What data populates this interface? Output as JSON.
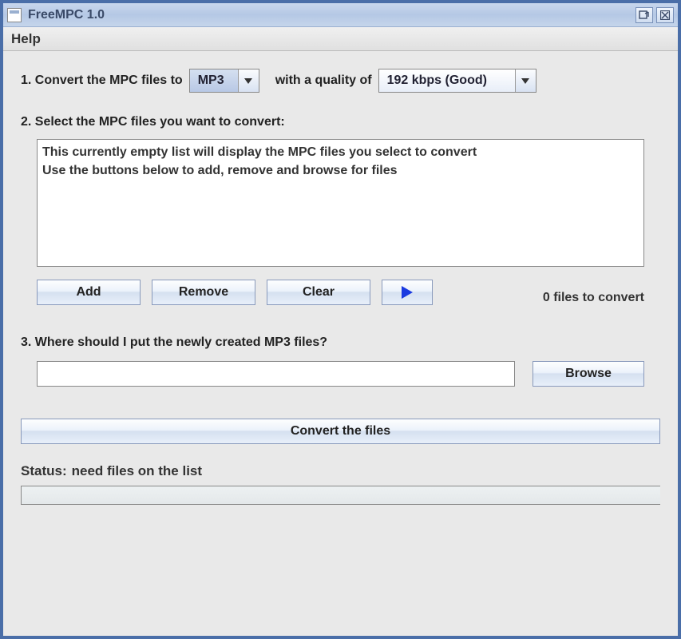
{
  "window": {
    "title": "FreeMPC 1.0"
  },
  "menubar": {
    "help": "Help"
  },
  "step1": {
    "label_before": "1. Convert the MPC files to",
    "format": "MP3",
    "label_mid": "with a quality of",
    "quality": "192 kbps (Good)"
  },
  "step2": {
    "label": "2. Select the MPC files you want to convert:",
    "list_line1": "This currently empty list will display the MPC files you select to convert",
    "list_line2": "Use the buttons below to add, remove and browse for files",
    "add": "Add",
    "remove": "Remove",
    "clear": "Clear",
    "count": "0 files to convert"
  },
  "step3": {
    "label": "3. Where should I put the newly created MP3 files?",
    "output_path": "",
    "browse": "Browse"
  },
  "convert": {
    "button": "Convert the files"
  },
  "status": {
    "label": "Status:",
    "text": "need files on the list"
  }
}
